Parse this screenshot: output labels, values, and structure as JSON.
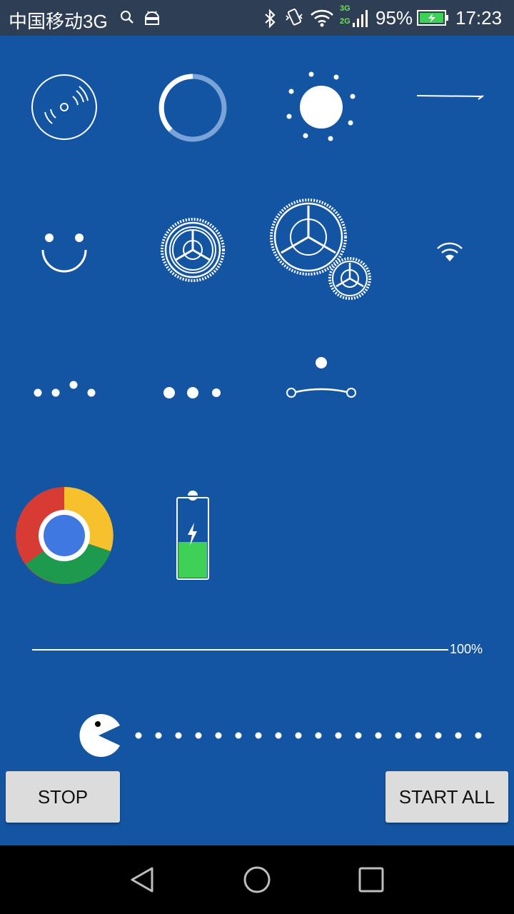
{
  "status_bar": {
    "carrier": "中国移动3G",
    "network_top": "3G",
    "network_bottom": "2G",
    "battery_percent": "95%",
    "time": "17:23",
    "icons": [
      "search-icon",
      "android-icon",
      "bluetooth-icon",
      "vibrate-icon",
      "wifi-icon",
      "signal-icon",
      "battery-charging-icon"
    ]
  },
  "animations": {
    "icons": [
      "vinyl-disc-icon",
      "loading-ring-icon",
      "sun-icon",
      "line-arrow-icon",
      "smiley-icon",
      "gear-icon",
      "double-gear-icon",
      "wifi-icon",
      "bouncing-dots-icon",
      "pulsing-dots-icon",
      "ball-swing-icon",
      "chrome-logo-icon",
      "charging-battery-icon",
      "pacman-icon"
    ],
    "accent_color": "#1455a3",
    "battery_fill_color": "#3fd058"
  },
  "progress": {
    "value_percent": 100,
    "label": "100%"
  },
  "buttons": {
    "stop_label": "STOP",
    "start_all_label": "START ALL"
  },
  "nav_bar": {
    "icons": [
      "back-icon",
      "home-icon",
      "recents-icon"
    ]
  }
}
